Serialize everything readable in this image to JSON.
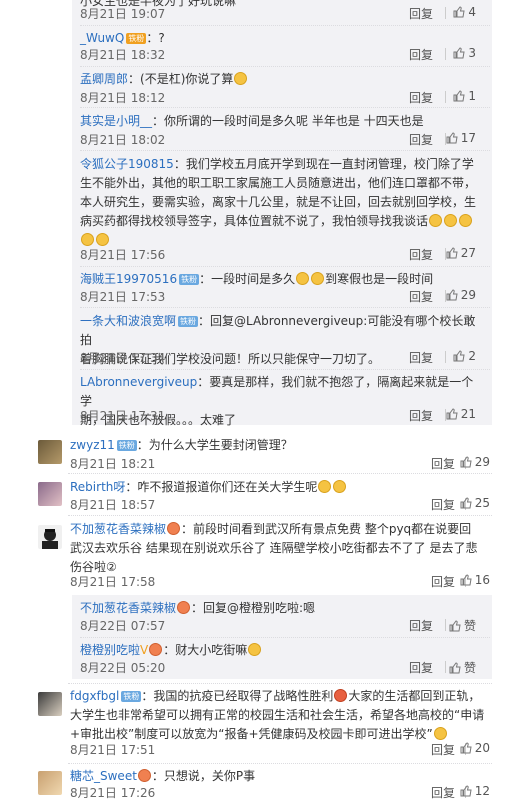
{
  "replies": [
    {
      "user": "",
      "text": "",
      "time": "8月21日 19:07",
      "reply": "回复",
      "likes": "4",
      "partial_text": "小女生也是半夜为了好玩说嘛"
    },
    {
      "user": "_WuwQ",
      "badge": "铁粉",
      "text": "：?",
      "time": "8月21日 18:32",
      "reply": "回复",
      "likes": "3"
    },
    {
      "user": "孟卿周郎",
      "text": "：(不是杠)你说了算",
      "time": "8月21日 18:12",
      "reply": "回复",
      "likes": "1"
    },
    {
      "user": "其实是小明__",
      "text": "：你所谓的一段时间是多久呢 半年也是 十四天也是",
      "time": "8月21日 18:02",
      "reply": "回复",
      "likes": "17"
    },
    {
      "user": "令狐公子190815",
      "text_lines": [
        "：我们学校五月底开学到现在一直封闭管理，校门除了学",
        "生不能外出，其他的职工职工家属施工人员随意进出，他们连口罩都不带，",
        "本人研究生，要需实验，离家十几公里，就是不让回，回去就别回学校，生",
        "病买药都得找校领导签字，具体位置就不说了，我怕领导找我谈话"
      ],
      "time": "8月21日 17:56",
      "reply": "回复",
      "likes": "27"
    },
    {
      "user": "海贼王19970516",
      "badge": "铁粉",
      "text": "：一段时间是多久",
      "text2": "到寒假也是一段时间",
      "time": "8月21日 17:53",
      "reply": "回复",
      "likes": "29"
    },
    {
      "user": "一条大和波浪宽啊",
      "badge": "铁粉",
      "text_lines": [
        "：回复@LAbronnevergiveup:可能没有哪个校长敢拍",
        "着胸脯说保证我们学校没问题！所以只能保守一刀切了。"
      ],
      "time": "8月21日 17:34",
      "reply": "回复",
      "likes": "2"
    },
    {
      "user": "LAbronnevergiveup",
      "text_lines": [
        "：要真是那样，我们就不抱怨了，隔离起来就是一个学",
        "期，国庆也不放假。。。太难了"
      ],
      "time": "8月21日 17:31",
      "reply": "回复",
      "likes": "21"
    }
  ],
  "comments": [
    {
      "user": "zwyz11",
      "badge": "铁粉",
      "text": "：为什么大学生要封闭管理？",
      "time": "8月21日 18:21",
      "reply": "回复",
      "likes": "29"
    },
    {
      "user": "Rebirth呀",
      "text": "：咋不报道报道你们还在关大学生呢",
      "time": "8月21日 18:57",
      "reply": "回复",
      "likes": "25"
    },
    {
      "user": "不加葱花香菜辣椒",
      "text_lines": [
        "：前段时间看到武汉所有景点免费  整个pyq都在说要回",
        "武汉去欢乐谷  结果现在别说欢乐谷了  连隔壁学校小吃街都去不了了  是去了悲",
        "伤谷啦②"
      ],
      "time": "8月21日 17:58",
      "reply": "回复",
      "likes": "16"
    },
    {
      "user": "fdgxfbgl",
      "badge": "铁粉",
      "text_lines": [
        "：我国的抗疫已经取得了战略性胜利",
        "大家的生活都回到正轨，",
        "大学生也非常希望可以拥有正常的校园生活和社会生活，希望各地高校的“申请",
        "+审批出校”制度可以放宽为“报备+凭健康码及校园卡即可进出学校”"
      ],
      "time": "8月21日 17:51",
      "reply": "回复",
      "likes": "20"
    },
    {
      "user": "糖芯_Sweet",
      "text": "：只想说，关你P事",
      "time": "8月21日 17:26",
      "reply": "回复",
      "likes": "12"
    }
  ],
  "sub_replies": [
    {
      "user": "不加葱花香菜辣椒",
      "text": "：回复@橙橙别吃啦:嗯",
      "time": "8月22日 07:57",
      "reply": "回复",
      "likes": "赞"
    },
    {
      "user": "橙橙别吃啦",
      "text": "：财大小吃街嘛",
      "time": "8月22日 05:20",
      "reply": "回复",
      "likes": "赞"
    }
  ],
  "badges": {
    "vip": "铁粉"
  },
  "colors": {
    "link": "#2c6fbf",
    "bg_sub": "#f2f2f5",
    "text": "#333333",
    "meta": "#666666"
  }
}
